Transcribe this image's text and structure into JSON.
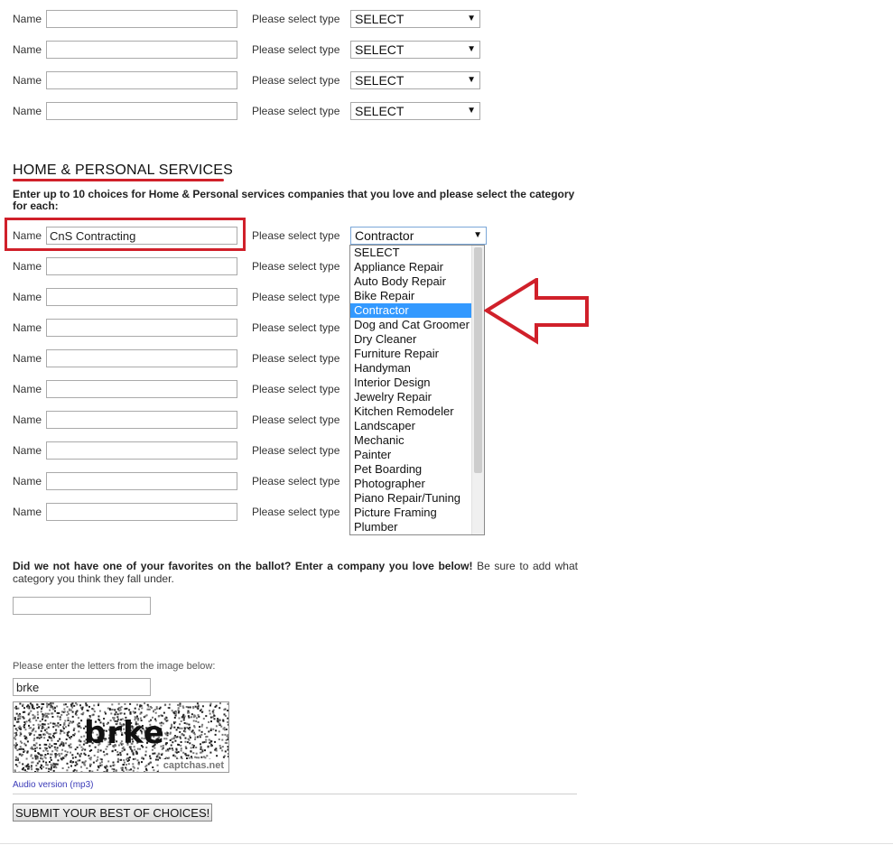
{
  "top_rows": [
    {
      "name_label": "Name",
      "name_value": "",
      "type_label": "Please select type",
      "type_value": "SELECT"
    },
    {
      "name_label": "Name",
      "name_value": "",
      "type_label": "Please select type",
      "type_value": "SELECT"
    },
    {
      "name_label": "Name",
      "name_value": "",
      "type_label": "Please select type",
      "type_value": "SELECT"
    },
    {
      "name_label": "Name",
      "name_value": "",
      "type_label": "Please select type",
      "type_value": "SELECT"
    }
  ],
  "section": {
    "title": "HOME & PERSONAL SERVICES",
    "intro": "Enter up to 10 choices for Home & Personal services companies that you love and please select the category for each:"
  },
  "home_rows": [
    {
      "name_label": "Name",
      "name_value": "CnS Contracting",
      "type_label": "Please select type",
      "type_value": "Contractor"
    },
    {
      "name_label": "Name",
      "name_value": "",
      "type_label": "Please select type"
    },
    {
      "name_label": "Name",
      "name_value": "",
      "type_label": "Please select type"
    },
    {
      "name_label": "Name",
      "name_value": "",
      "type_label": "Please select type"
    },
    {
      "name_label": "Name",
      "name_value": "",
      "type_label": "Please select type"
    },
    {
      "name_label": "Name",
      "name_value": "",
      "type_label": "Please select type"
    },
    {
      "name_label": "Name",
      "name_value": "",
      "type_label": "Please select type"
    },
    {
      "name_label": "Name",
      "name_value": "",
      "type_label": "Please select type"
    },
    {
      "name_label": "Name",
      "name_value": "",
      "type_label": "Please select type"
    },
    {
      "name_label": "Name",
      "name_value": "",
      "type_label": "Please select type"
    }
  ],
  "dropdown": {
    "options": [
      "SELECT",
      "Appliance Repair",
      "Auto Body Repair",
      "Bike Repair",
      "Contractor",
      "Dog and Cat Groomer",
      "Dry Cleaner",
      "Furniture Repair",
      "Handyman",
      "Interior Design",
      "Jewelry Repair",
      "Kitchen Remodeler",
      "Landscaper",
      "Mechanic",
      "Painter",
      "Pet Boarding",
      "Photographer",
      "Piano Repair/Tuning",
      "Picture Framing",
      "Plumber"
    ],
    "selected": "Contractor"
  },
  "missing": {
    "bold_text": "Did we not have one of your favorites on the ballot? Enter a company you love below!",
    "rest_text": " Be sure to add what category you think they fall under.",
    "input_value": ""
  },
  "captcha": {
    "label": "Please enter the letters from the image below:",
    "input_value": "brke",
    "image_text": "brke",
    "brand": "captchas.net",
    "audio_link": "Audio version (mp3)"
  },
  "submit_label": "SUBMIT YOUR BEST OF CHOICES!",
  "colors": {
    "annotation_red": "#d0202a",
    "selection_blue": "#3399ff",
    "link_blue": "#3a3ab8"
  }
}
